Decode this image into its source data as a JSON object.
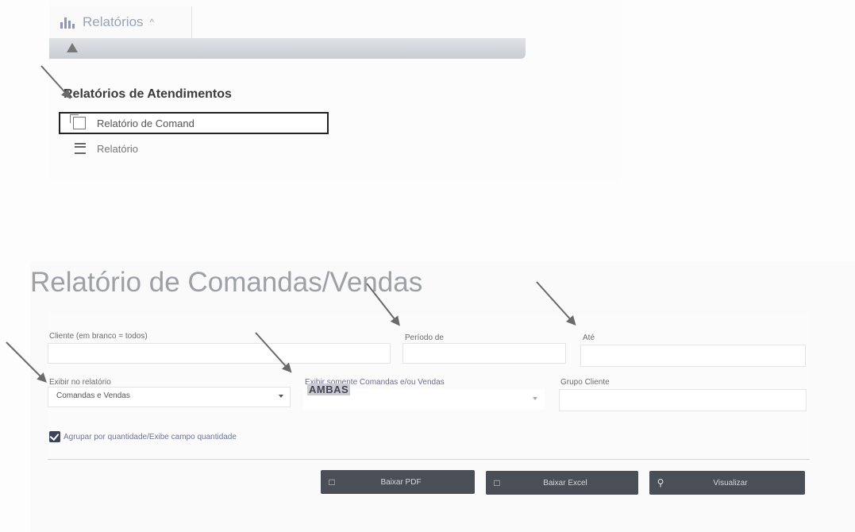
{
  "top_menu": {
    "tab_label": "Relatórios",
    "tab_icon": "bar-chart-icon",
    "tab_chevron": "^",
    "section_heading": "Relatórios de Atendimentos",
    "items": [
      {
        "label": "Relatório de Comand",
        "icon": "document-icon"
      },
      {
        "label": "Relatório",
        "icon": "list-icon"
      }
    ]
  },
  "form": {
    "title": "Relatório de Comandas/Vendas",
    "cliente_label": "Cliente (em branco = todos)",
    "cliente_value": "",
    "periodo_label": "Período de",
    "periodo_value": "",
    "ate_label": "Até",
    "ate_value": "",
    "exibir_label": "Exibir no relatório",
    "exibir_value": "Comandas e Vendas",
    "somente_label": "Exibir somente Comandas e/ou Vendas",
    "somente_value": "AMBAS",
    "grupo_label": "Grupo Cliente",
    "grupo_value": "",
    "checkbox_label": "Agrupar por quantidade/Exibe campo quantidade",
    "checkbox_checked": true,
    "buttons": {
      "pdf": {
        "label": "Baixar PDF",
        "icon": "file-pdf-icon"
      },
      "excel": {
        "label": "Baixar Excel",
        "icon": "file-excel-icon"
      },
      "view": {
        "label": "Visualizar",
        "icon": "search-icon"
      }
    }
  }
}
